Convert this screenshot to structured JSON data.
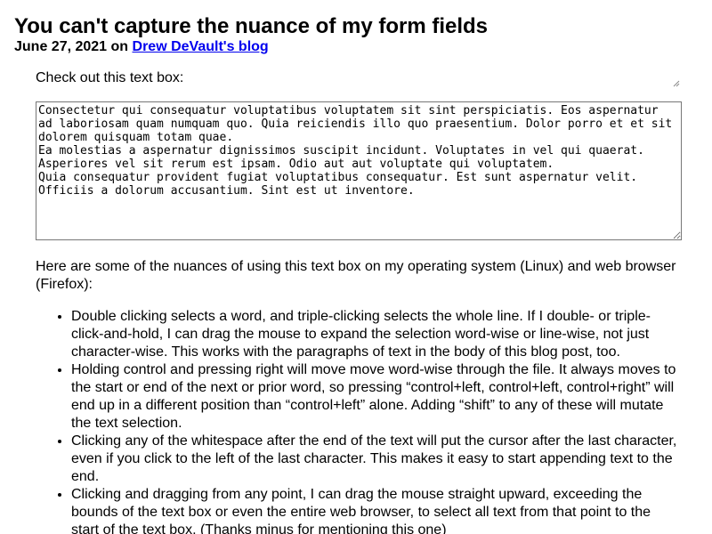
{
  "post": {
    "title": "You can't capture the nuance of my form fields",
    "date": "June 27, 2021",
    "byline_joiner": " on ",
    "blog_link": "Drew DeVault's blog"
  },
  "content": {
    "intro": "Check out this text box:",
    "textbox_value": "Consectetur qui consequatur voluptatibus voluptatem sit sint perspiciatis. Eos aspernatur ad laboriosam quam numquam quo. Quia reiciendis illo quo praesentium. Dolor porro et et sit dolorem quisquam totam quae.\nEa molestias a aspernatur dignissimos suscipit incidunt. Voluptates in vel qui quaerat. Asperiores vel sit rerum est ipsam. Odio aut aut voluptate qui voluptatem.\nQuia consequatur provident fugiat voluptatibus consequatur. Est sunt aspernatur velit. Officiis a dolorum accusantium. Sint est ut inventore.",
    "nuances_intro": "Here are some of the nuances of using this text box on my operating system (Linux) and web browser (Firefox):",
    "nuances": [
      "Double clicking selects a word, and triple-clicking selects the whole line. If I double- or triple-click-and-hold, I can drag the mouse to expand the selection word-wise or line-wise, not just character-wise. This works with the paragraphs of text in the body of this blog post, too.",
      "Holding control and pressing right will move move word-wise through the file. It always moves to the start or end of the next or prior word, so pressing “control+left, control+left, control+right” will end up in a different position than “control+left” alone. Adding “shift” to any of these will mutate the text selection.",
      "Clicking any of the whitespace after the end of the text will put the cursor after the last character, even if you click to the left of the last character. This makes it easy to start appending text to the end.",
      "Clicking and dragging from any point, I can drag the mouse straight upward, exceeding the bounds of the text box or even the entire web browser, to select all text from that point to the start of the text box. (Thanks minus for mentioning this one)"
    ]
  },
  "colors": {
    "link": "#0000ee",
    "textbox_border": "#767676"
  }
}
